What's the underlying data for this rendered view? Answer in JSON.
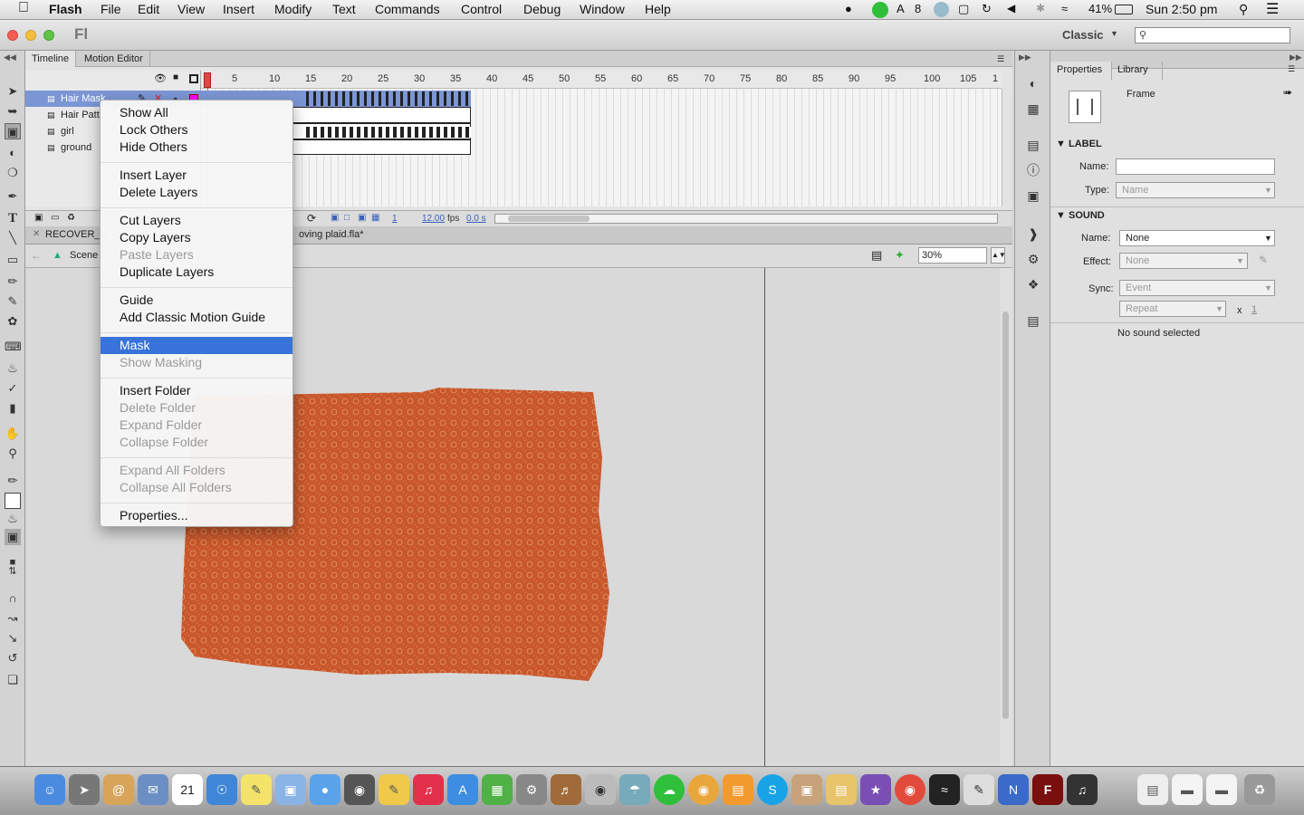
{
  "menubar": {
    "apple": "",
    "items": [
      "Flash",
      "File",
      "Edit",
      "View",
      "Insert",
      "Modify",
      "Text",
      "Commands",
      "Control",
      "Debug",
      "Window",
      "Help"
    ],
    "status_a8": "8",
    "battery": "41%",
    "clock": "Sun 2:50 pm"
  },
  "appbar": {
    "logo": "Fl",
    "workspace": "Classic",
    "search_placeholder": ""
  },
  "timeline": {
    "tabs": [
      "Timeline",
      "Motion Editor"
    ],
    "ruler_ticks": [
      "1",
      "5",
      "10",
      "15",
      "20",
      "25",
      "30",
      "35",
      "40",
      "45",
      "50",
      "55",
      "60",
      "65",
      "70",
      "75",
      "80",
      "85",
      "90",
      "95",
      "100",
      "105",
      "1"
    ],
    "layers": [
      "Hair Mask",
      "Hair Patt",
      "girl",
      "ground"
    ],
    "footer": {
      "frame": "1",
      "fps": "12.00",
      "fps_unit": "fps",
      "time": "0.0 s"
    }
  },
  "document": {
    "tab_recover": "RECOVER_U",
    "tab_file": "oving plaid.fla*",
    "scene": "Scene 2",
    "zoom": "30%"
  },
  "context_menu": {
    "groups": [
      [
        {
          "label": "Show All",
          "enabled": true
        },
        {
          "label": "Lock Others",
          "enabled": true
        },
        {
          "label": "Hide Others",
          "enabled": true
        }
      ],
      [
        {
          "label": "Insert Layer",
          "enabled": true
        },
        {
          "label": "Delete Layers",
          "enabled": true
        }
      ],
      [
        {
          "label": "Cut Layers",
          "enabled": true
        },
        {
          "label": "Copy Layers",
          "enabled": true
        },
        {
          "label": "Paste Layers",
          "enabled": false
        },
        {
          "label": "Duplicate Layers",
          "enabled": true
        }
      ],
      [
        {
          "label": "Guide",
          "enabled": true
        },
        {
          "label": "Add Classic Motion Guide",
          "enabled": true
        }
      ],
      [
        {
          "label": "Mask",
          "enabled": true,
          "selected": true
        },
        {
          "label": "Show Masking",
          "enabled": false
        }
      ],
      [
        {
          "label": "Insert Folder",
          "enabled": true
        },
        {
          "label": "Delete Folder",
          "enabled": false
        },
        {
          "label": "Expand Folder",
          "enabled": false
        },
        {
          "label": "Collapse Folder",
          "enabled": false
        }
      ],
      [
        {
          "label": "Expand All Folders",
          "enabled": false
        },
        {
          "label": "Collapse All Folders",
          "enabled": false
        }
      ],
      [
        {
          "label": "Properties...",
          "enabled": true
        }
      ]
    ]
  },
  "properties": {
    "tabs": [
      "Properties",
      "Library"
    ],
    "type": "Frame",
    "label_section": "LABEL",
    "name_label": "Name:",
    "type_label": "Type:",
    "type_value": "Name",
    "sound_section": "SOUND",
    "sound_name_label": "Name:",
    "sound_name_value": "None",
    "effect_label": "Effect:",
    "effect_value": "None",
    "sync_label": "Sync:",
    "sync_value": "Event",
    "repeat_value": "Repeat",
    "repeat_x": "x",
    "repeat_count": "1",
    "status": "No sound selected"
  },
  "colors": {
    "accent": "#3873d9",
    "selected_layer": "#7b96d4",
    "shape_fill": "#c8572b",
    "playhead": "#e34545"
  },
  "dock_icons": [
    "finder",
    "launchpad",
    "address-book",
    "mail",
    "calendar",
    "safari",
    "stickies",
    "preview",
    "messages",
    "facetime",
    "textedit",
    "itunes",
    "app-store",
    "numbers",
    "system-preferences",
    "garageband",
    "photo-booth",
    "network",
    "green-app",
    "chrome-like",
    "ibooks",
    "skype",
    "package",
    "archive",
    "imovie",
    "chrome",
    "activity-monitor",
    "scripteditor",
    "n-app",
    "flash",
    "sound-app",
    "pdf",
    "drive",
    "drive2",
    "trash"
  ]
}
